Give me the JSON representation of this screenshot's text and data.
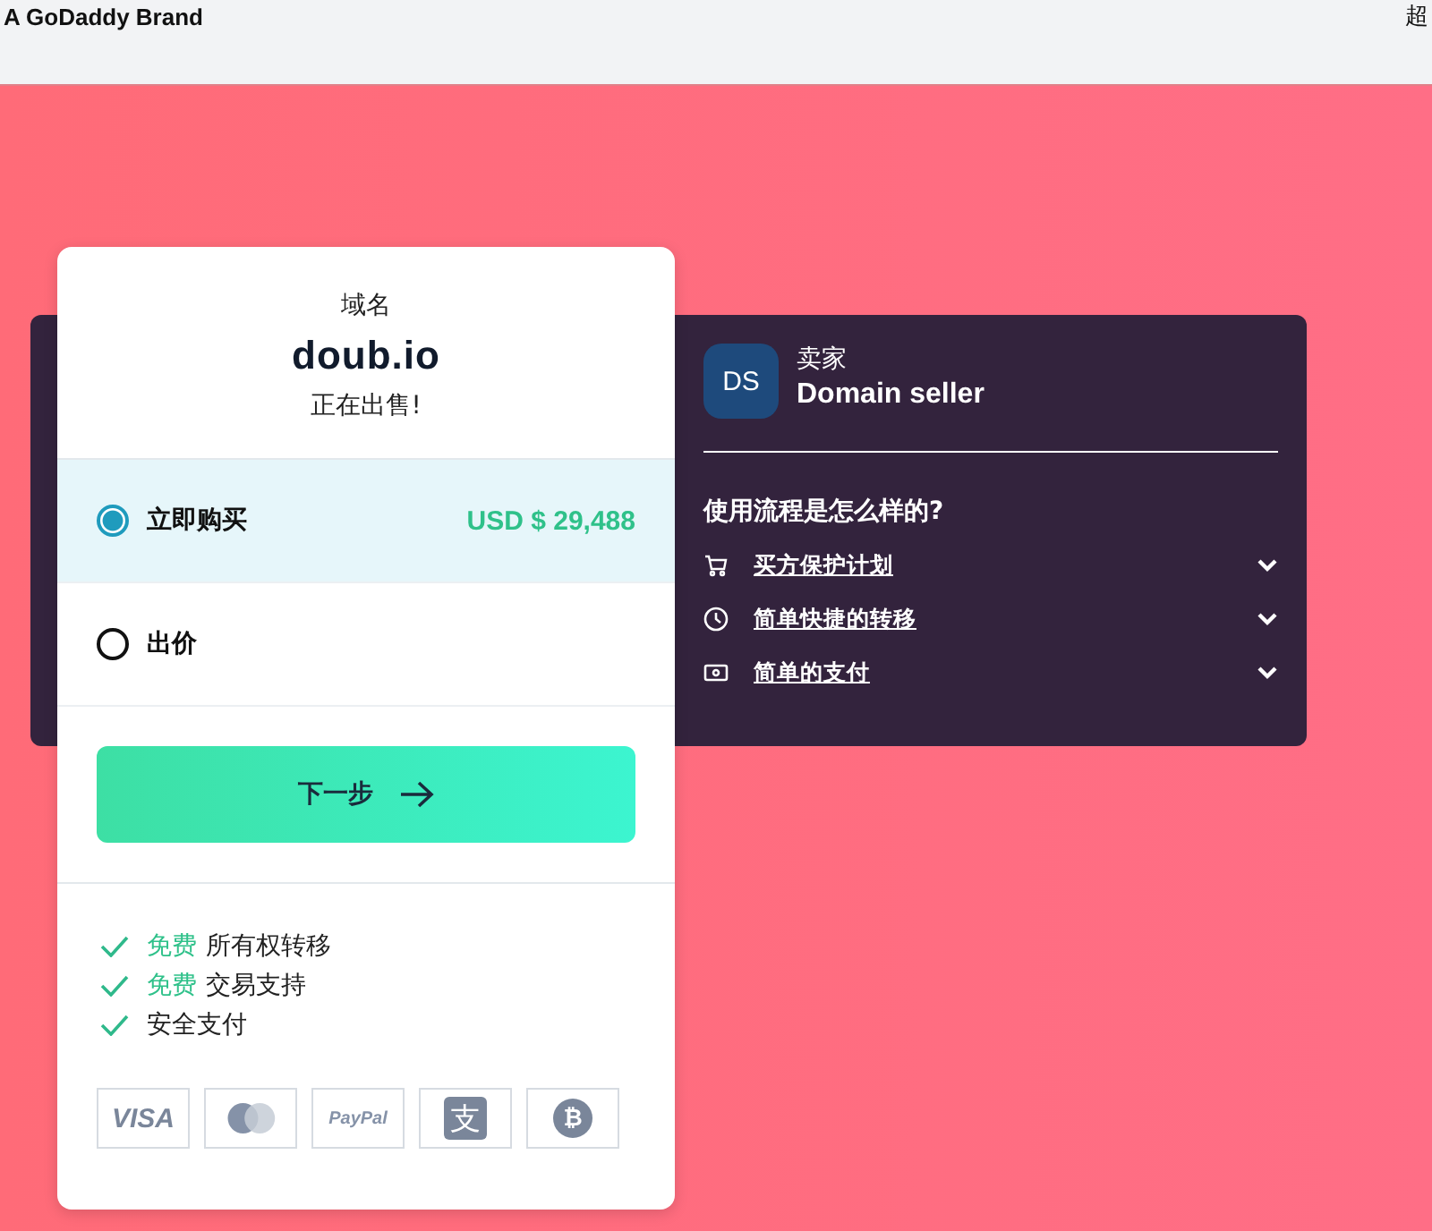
{
  "header": {
    "brand": "A GoDaddy Brand",
    "right_text": "超"
  },
  "card": {
    "label": "域名",
    "domain": "doub.io",
    "status": "正在出售!",
    "options": [
      {
        "label": "立即购买",
        "price": "USD $ 29,488",
        "selected": true
      },
      {
        "label": "出价",
        "selected": false
      }
    ],
    "next_button": {
      "label": "下一步"
    },
    "benefits": [
      {
        "highlight": "免费",
        "text": "所有权转移"
      },
      {
        "highlight": "免费",
        "text": "交易支持"
      },
      {
        "text": "安全支付"
      }
    ],
    "payment_methods": [
      {
        "kind": "visa",
        "label": "VISA"
      },
      {
        "kind": "mastercard"
      },
      {
        "kind": "paypal",
        "label": "PayPal"
      },
      {
        "kind": "alipay",
        "label": "支"
      },
      {
        "kind": "bitcoin",
        "label": "₿"
      }
    ]
  },
  "seller": {
    "initials": "DS",
    "role": "卖家",
    "name": "Domain seller",
    "question": "使用流程是怎么样的?",
    "faq": [
      {
        "kind": "cart",
        "label": "买方保护计划",
        "expanded": false
      },
      {
        "kind": "clock",
        "label": "简单快捷的转移",
        "expanded": false
      },
      {
        "kind": "cash",
        "label": "简单的支付",
        "expanded": false
      }
    ]
  }
}
